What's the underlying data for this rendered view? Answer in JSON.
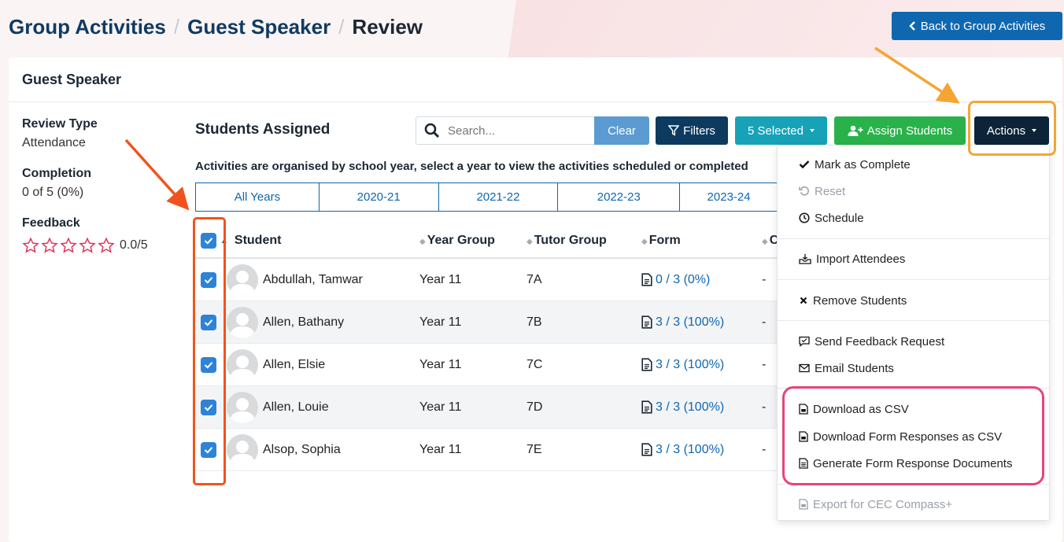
{
  "breadcrumb": {
    "parent": "Group Activities",
    "child": "Guest Speaker",
    "current": "Review",
    "separator": "/"
  },
  "back_button": {
    "label": "Back to Group Activities"
  },
  "card": {
    "title": "Guest Speaker"
  },
  "sidebar": {
    "review_type_label": "Review Type",
    "review_type_value": "Attendance",
    "completion_label": "Completion",
    "completion_value": "0 of 5 (0%)",
    "feedback_label": "Feedback",
    "rating_value": "0.0/5",
    "rating": 0
  },
  "students": {
    "title": "Students Assigned",
    "search_placeholder": "Search...",
    "clear_label": "Clear",
    "filters_label": "Filters",
    "selected_label": "5 Selected",
    "assign_label": "Assign Students",
    "actions_label": "Actions",
    "notice": "Activities are organised by school year, select a year to view the activities scheduled or completed",
    "years": [
      "All Years",
      "2020-21",
      "2021-22",
      "2022-23",
      "2023-24"
    ],
    "columns": {
      "student": "Student",
      "year_group": "Year Group",
      "tutor_group": "Tutor Group",
      "form": "Form",
      "more": "C"
    },
    "rows": [
      {
        "name": "Abdullah, Tamwar",
        "year": "Year 11",
        "tutor": "7A",
        "form": "0 / 3 (0%)",
        "extra": "-"
      },
      {
        "name": "Allen, Bathany",
        "year": "Year 11",
        "tutor": "7B",
        "form": "3 / 3 (100%)",
        "extra": "-"
      },
      {
        "name": "Allen, Elsie",
        "year": "Year 11",
        "tutor": "7C",
        "form": "3 / 3 (100%)",
        "extra": "-"
      },
      {
        "name": "Allen, Louie",
        "year": "Year 11",
        "tutor": "7D",
        "form": "3 / 3 (100%)",
        "extra": "-"
      },
      {
        "name": "Alsop, Sophia",
        "year": "Year 11",
        "tutor": "7E",
        "form": "3 / 3 (100%)",
        "extra": "-"
      }
    ]
  },
  "actions_menu": {
    "mark_complete": "Mark as Complete",
    "reset": "Reset",
    "schedule": "Schedule",
    "import_attendees": "Import Attendees",
    "remove_students": "Remove Students",
    "send_feedback": "Send Feedback Request",
    "email_students": "Email Students",
    "download_csv": "Download as CSV",
    "download_form_csv": "Download Form Responses as CSV",
    "generate_docs": "Generate Form Response Documents",
    "export_cec": "Export for CEC Compass+"
  },
  "colors": {
    "primary": "#0f67b0",
    "dark": "#0d2438",
    "success": "#2ab24a",
    "info": "#17a2b8",
    "highlight_orange": "#f5a534",
    "highlight_red": "#f0541c",
    "highlight_pink": "#e6457a"
  }
}
